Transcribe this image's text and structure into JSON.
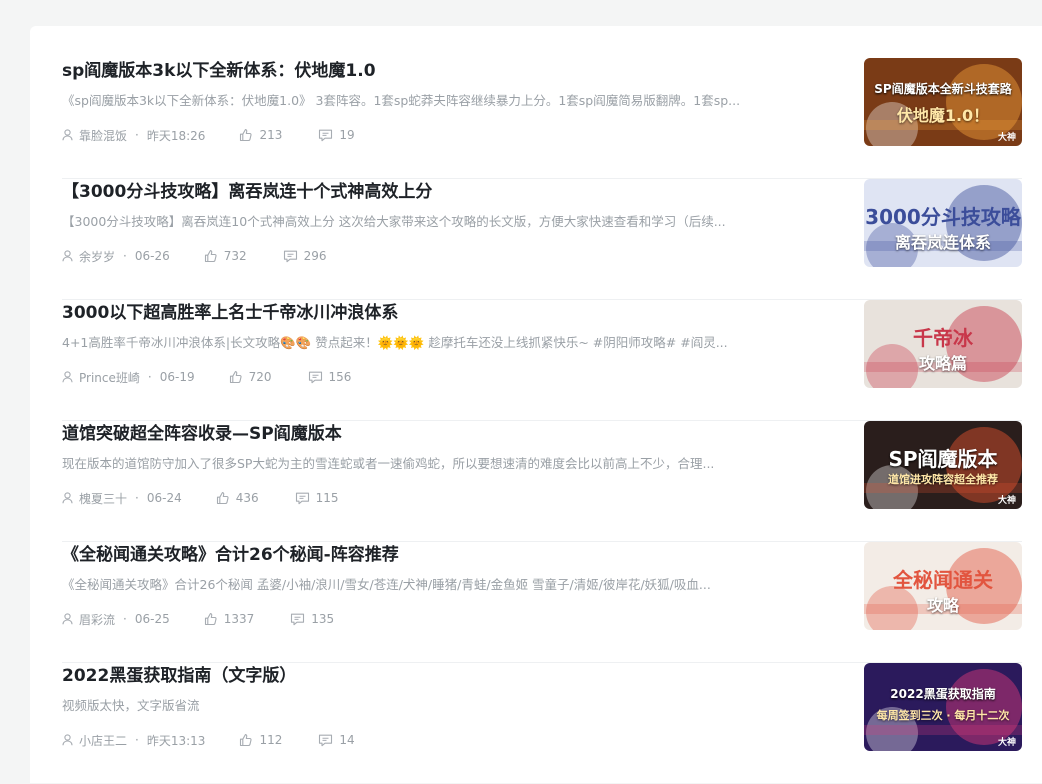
{
  "articles": [
    {
      "title": "sp阎魔版本3k以下全新体系：伏地魔1.0",
      "summary": "《sp阎魔版本3k以下全新体系：伏地魔1.0》 3套阵容。1套sp蛇莽夫阵容继续暴力上分。1套sp阎魔简易版翻牌。1套sp...",
      "author": "靠脸混饭",
      "time": "昨天18:26",
      "likes": "213",
      "comments": "19",
      "thumb": {
        "line1": "SP阎魔版本全新斗技套路",
        "line2": "伏地魔1.0！",
        "corner": "大神",
        "bg": "#7a3b16",
        "accent": "#f2a03a"
      }
    },
    {
      "title": "【3000分斗技攻略】离吞岚连十个式神高效上分",
      "summary": "【3000分斗技攻略】离吞岚连10个式神高效上分 这次给大家带来这个攻略的长文版，方便大家快速查看和学习（后续...",
      "author": "余岁岁",
      "time": "06-26",
      "likes": "732",
      "comments": "296",
      "thumb": {
        "line1": "3000分斗技攻略",
        "line2": "离吞岚连体系",
        "corner": "",
        "bg": "#dfe4f3",
        "accent": "#3b4d9a"
      }
    },
    {
      "title": "3000以下超高胜率上名士千帝冰川冲浪体系",
      "summary": "4+1高胜率千帝冰川冲浪体系|长文攻略🎨🎨 赞点起来！🌞🌞🌞 趁摩托车还没上线抓紧快乐~ #阴阳师攻略# #阎灵...",
      "author": "Prince班崎",
      "time": "06-19",
      "likes": "720",
      "comments": "156",
      "thumb": {
        "line1": "千帝冰",
        "line2": "攻略篇",
        "corner": "",
        "bg": "#e8e2dc",
        "accent": "#c8374a"
      }
    },
    {
      "title": "道馆突破超全阵容收录—SP阎魔版本",
      "summary": "现在版本的道馆防守加入了很多SP大蛇为主的雪连蛇或者一速偷鸡蛇，所以要想速清的难度会比以前高上不少，合理...",
      "author": "槐夏三十",
      "time": "06-24",
      "likes": "436",
      "comments": "115",
      "thumb": {
        "line1": "SP阎魔版本",
        "line2": "道馆进攻阵容超全推荐",
        "corner": "大神",
        "bg": "#2a1e1c",
        "accent": "#e8552e"
      }
    },
    {
      "title": "《全秘闻通关攻略》合计26个秘闻-阵容推荐",
      "summary": "《全秘闻通关攻略》合计26个秘闻 孟婆/小袖/浪川/雪女/苍连/犬神/睡猪/青蛙/金鱼姬 雪童子/清姬/彼岸花/妖狐/吸血...",
      "author": "眉彩流",
      "time": "06-25",
      "likes": "1337",
      "comments": "135",
      "thumb": {
        "line1": "全秘闻通关",
        "line2": "攻略",
        "corner": "",
        "bg": "#f3ece6",
        "accent": "#e2553f"
      }
    },
    {
      "title": "2022黑蛋获取指南（文字版）",
      "summary": "视频版太快，文字版省流",
      "author": "小店王二",
      "time": "昨天13:13",
      "likes": "112",
      "comments": "14",
      "thumb": {
        "line1": "2022黑蛋获取指南",
        "line2": "每周签到三次 · 每月十二次",
        "corner": "大神",
        "bg": "#2b1a5c",
        "accent": "#e23a7a"
      }
    }
  ],
  "icons": {
    "author": "user-icon",
    "likes": "thumbs-up-icon",
    "comments": "comment-icon"
  },
  "colors": {
    "title": "#1e2227",
    "muted": "#9aa0a6",
    "divider": "#eef0f2",
    "background": "#f4f5f5"
  }
}
